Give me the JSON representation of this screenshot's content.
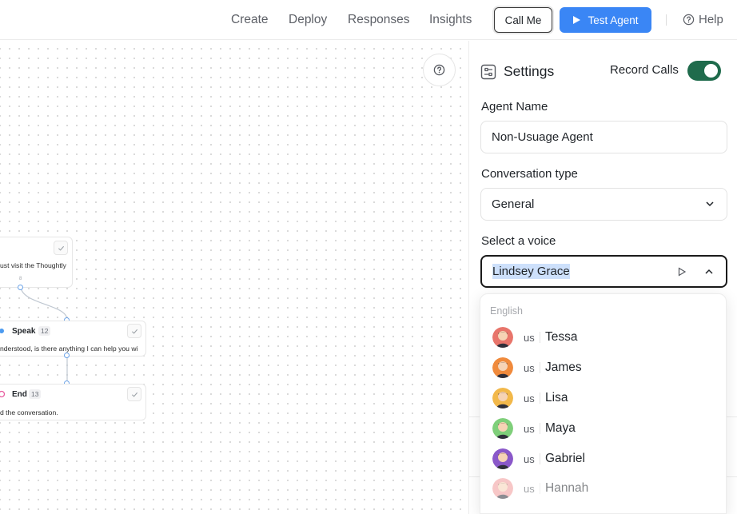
{
  "nav": {
    "links": [
      "Create",
      "Deploy",
      "Responses",
      "Insights"
    ],
    "call_me": "Call Me",
    "test_agent": "Test Agent",
    "help": "Help"
  },
  "canvas": {
    "nodes": [
      {
        "text": "ust visit the Thoughtly",
        "port_label": "8"
      },
      {
        "title": "Speak",
        "badge": "12",
        "text": "nderstood, is there anything I can help you wi"
      },
      {
        "title": "End",
        "badge": "13",
        "text": "d the conversation."
      }
    ]
  },
  "settings": {
    "title": "Settings",
    "record_calls_label": "Record Calls",
    "record_calls_on": true,
    "agent_name_label": "Agent Name",
    "agent_name_value": "Non-Usuage Agent",
    "conversation_type_label": "Conversation type",
    "conversation_type_value": "General",
    "voice_label": "Select a voice",
    "voice_value": "Lindsey Grace"
  },
  "voice_dropdown": {
    "group": "English",
    "voices": [
      {
        "lang": "us",
        "name": "Tessa",
        "color": "#e8756b"
      },
      {
        "lang": "us",
        "name": "James",
        "color": "#f08a3c"
      },
      {
        "lang": "us",
        "name": "Lisa",
        "color": "#f2b84a"
      },
      {
        "lang": "us",
        "name": "Maya",
        "color": "#7fcf7a"
      },
      {
        "lang": "us",
        "name": "Gabriel",
        "color": "#8a58c9"
      },
      {
        "lang": "us",
        "name": "Hannah",
        "color": "#f29a9a"
      }
    ]
  },
  "colors": {
    "accent": "#3a86f5",
    "toggle": "#1f6b4c",
    "selection": "#cde0fb"
  }
}
